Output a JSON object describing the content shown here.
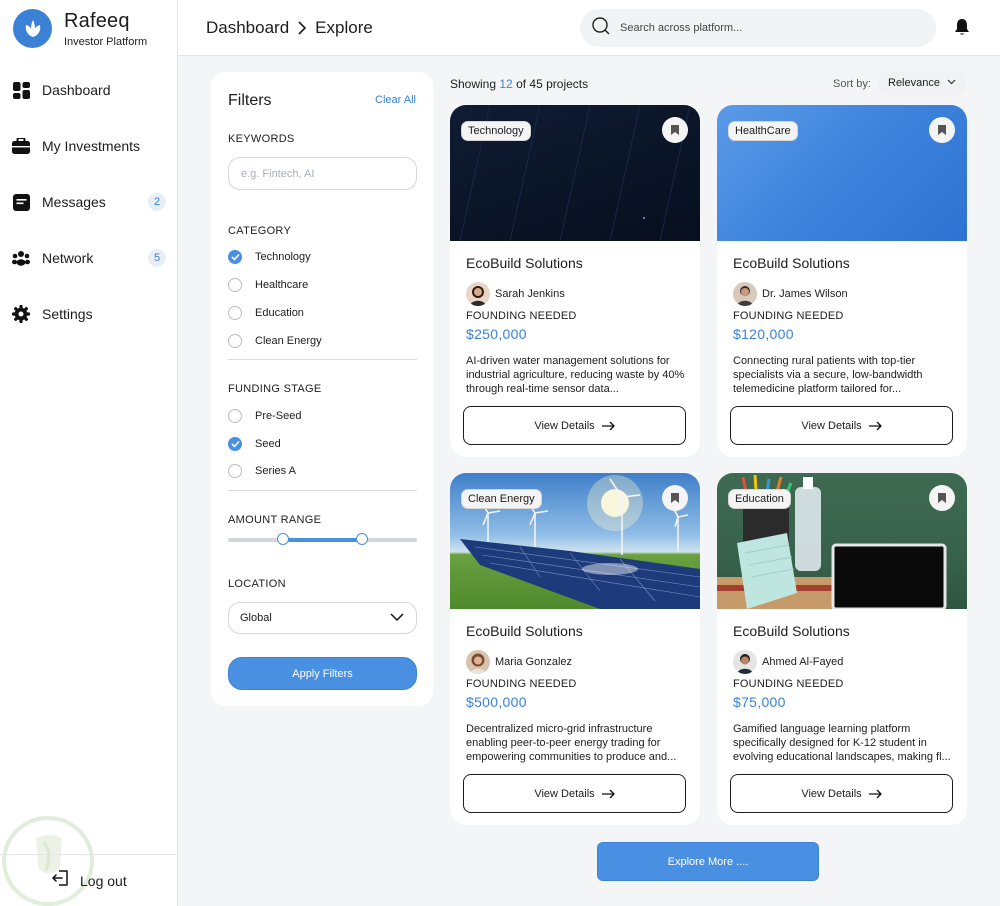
{
  "brand": {
    "name": "Rafeeq",
    "subtitle": "Investor Platform"
  },
  "nav": {
    "items": [
      {
        "label": "Dashboard",
        "icon": "dashboard-icon",
        "badge": ""
      },
      {
        "label": "My Investments",
        "icon": "briefcase-icon",
        "badge": ""
      },
      {
        "label": "Messages",
        "icon": "message-icon",
        "badge": "2"
      },
      {
        "label": "Network",
        "icon": "network-icon",
        "badge": "5"
      },
      {
        "label": "Settings",
        "icon": "gear-icon",
        "badge": ""
      }
    ],
    "logout_label": "Log out"
  },
  "header": {
    "breadcrumb": [
      "Dashboard",
      "Explore"
    ],
    "search_placeholder": "Search across platform..."
  },
  "filters": {
    "title": "Filters",
    "clear_label": "Clear All",
    "keywords_label": "KEYWORDS",
    "keywords_placeholder": "e.g. Fintech, AI",
    "category_label": "CATEGORY",
    "categories": [
      {
        "label": "Technology",
        "checked": true
      },
      {
        "label": "Healthcare",
        "checked": false
      },
      {
        "label": "Education",
        "checked": false
      },
      {
        "label": "Clean Energy",
        "checked": false
      }
    ],
    "stage_label": "FUNDING STAGE",
    "stages": [
      {
        "label": "Pre-Seed",
        "checked": false
      },
      {
        "label": "Seed",
        "checked": true
      },
      {
        "label": "Series A",
        "checked": false
      }
    ],
    "amount_label": "AMOUNT RANGE",
    "amount_range_fraction": [
      0.29,
      0.71
    ],
    "location_label": "LOCATION",
    "location_value": "Global",
    "apply_label": "Apply Filters"
  },
  "results": {
    "showing_prefix": "Showing",
    "shown_count": "12",
    "of_text": "of 45 projects",
    "sort_label": "Sort by:",
    "sort_value": "Relevance"
  },
  "cards": [
    {
      "tag": "Technology",
      "title": "EcoBuild Solutions",
      "person": "Sarah Jenkins",
      "need_label": "FOUNDING NEEDED",
      "amount": "$250,000",
      "description": "AI-driven water management solutions for industrial agriculture, reducing waste by 40% through real-time sensor data...",
      "button_label": "View Details"
    },
    {
      "tag": "HealthCare",
      "title": "EcoBuild Solutions",
      "person": "Dr. James Wilson",
      "need_label": "FOUNDING NEEDED",
      "amount": "$120,000",
      "description": "Connecting rural patients with top-tier specialists via a secure, low-bandwidth telemedicine platform tailored for...",
      "button_label": "View Details"
    },
    {
      "tag": "Clean Energy",
      "title": "EcoBuild Solutions",
      "person": "Maria Gonzalez",
      "need_label": "FOUNDING NEEDED",
      "amount": "$500,000",
      "description": "Decentralized micro-grid infrastructure enabling peer-to-peer energy trading for empowering communities to produce and...",
      "button_label": "View Details"
    },
    {
      "tag": "Education",
      "title": "EcoBuild Solutions",
      "person": "Ahmed Al-Fayed",
      "need_label": "FOUNDING NEEDED",
      "amount": "$75,000",
      "description": "Gamified language learning platform specifically designed for K-12 student in evolving educational landscapes, making fl...",
      "button_label": "View Details"
    }
  ],
  "explore_label": "Explore More ....",
  "colors": {
    "accent": "#4a90e2",
    "brand": "#3b82d6",
    "background": "#f4f5f7"
  }
}
